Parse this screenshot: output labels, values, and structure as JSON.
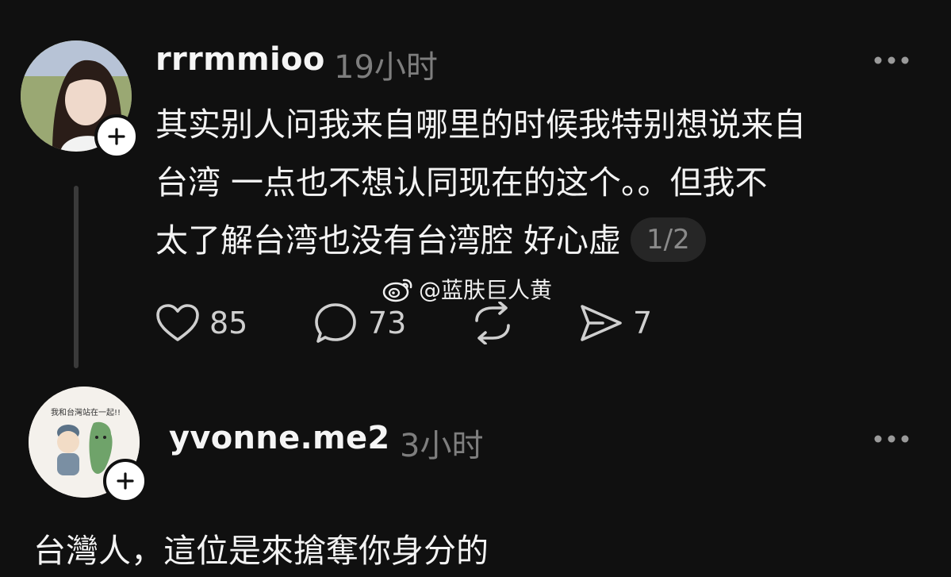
{
  "post": {
    "username": "rrrmmioo",
    "time": "19小时",
    "lines": [
      "其实别人问我来自哪里的时候我特别想说来自",
      "台湾 一点也不想认同现在的这个。。但我不",
      "太了解台湾也没有台湾腔 好心虚"
    ],
    "page_indicator": "1/2",
    "watermark": "@蓝肤巨人黄",
    "like_count": "85",
    "comment_count": "73",
    "share_count": "7"
  },
  "reply": {
    "username": "yvonne.me2",
    "time": "3小时",
    "avatar_caption": "我和台灣站在一起!!",
    "text": "台灣人，這位是來搶奪你身分的"
  },
  "colors": {
    "background": "#101010",
    "text": "#f3f3f3",
    "muted": "#7e7e7e"
  },
  "icons": [
    "plus-icon",
    "more-icon",
    "heart-icon",
    "comment-icon",
    "repost-icon",
    "send-icon",
    "weibo-icon"
  ]
}
